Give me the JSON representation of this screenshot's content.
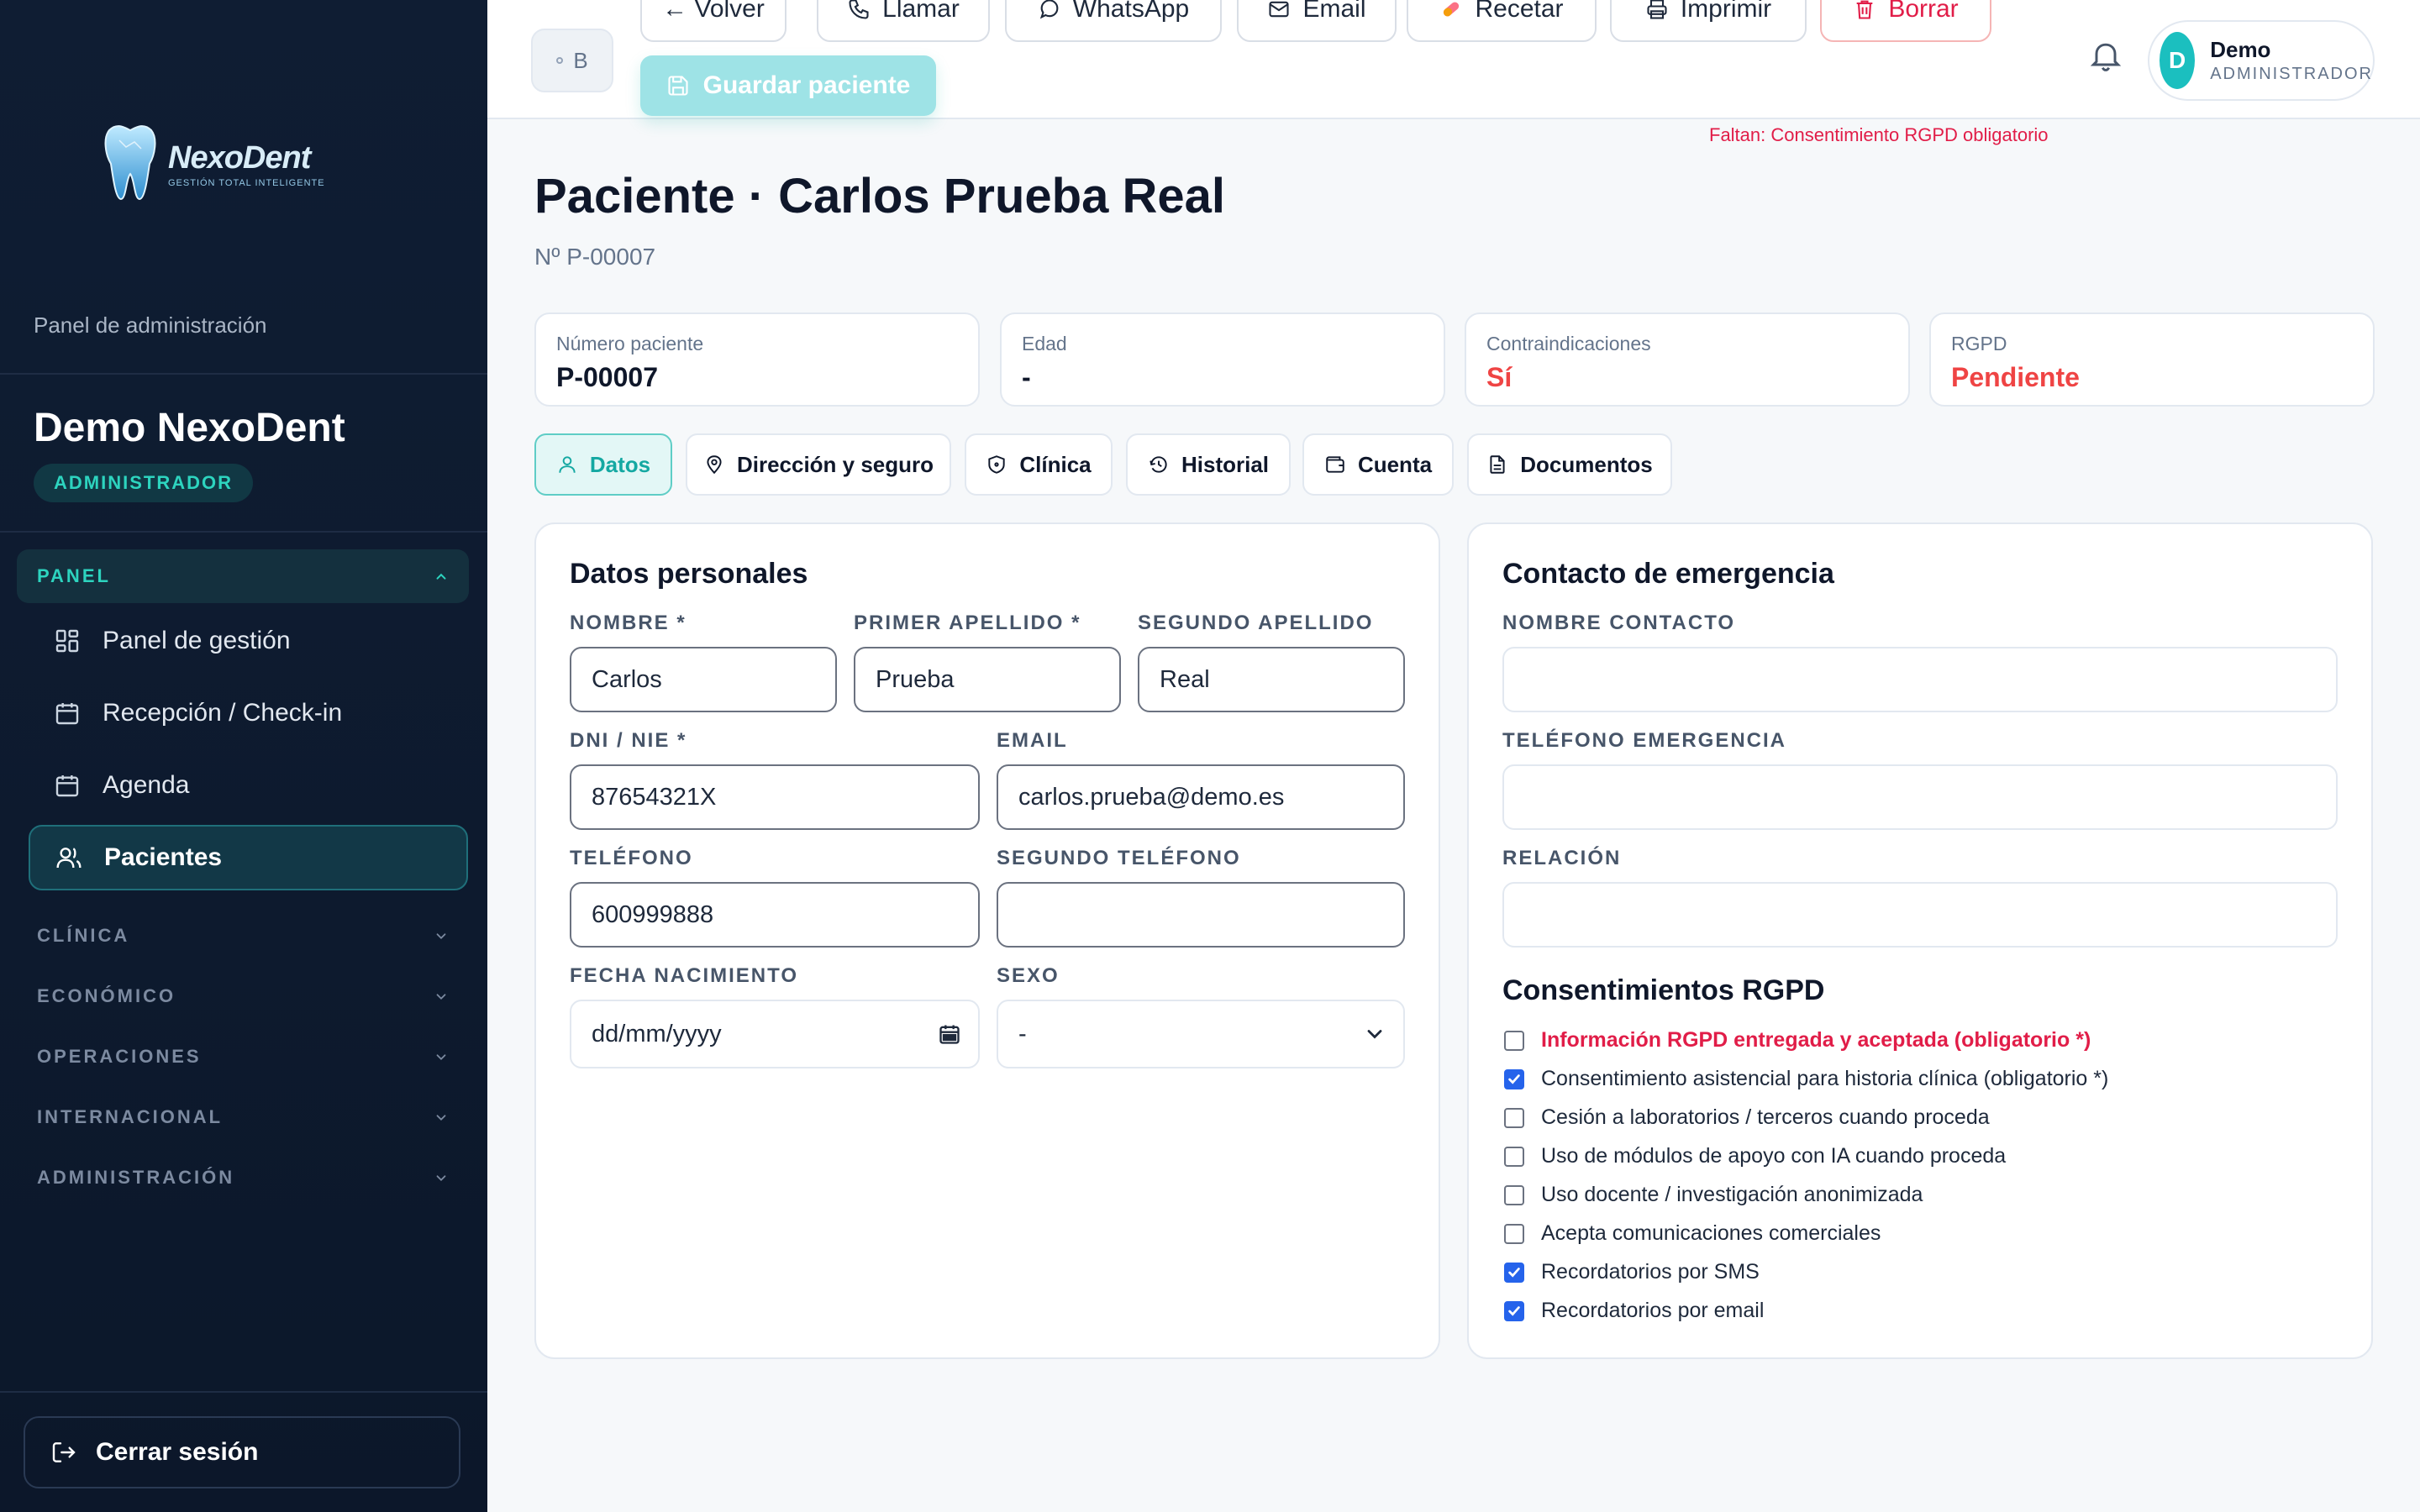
{
  "sidebar": {
    "logo_name": "NexoDent",
    "logo_tagline": "GESTIÓN TOTAL INTELIGENTE",
    "panel_label": "Panel de administración",
    "org_name": "Demo NexoDent",
    "role": "ADMINISTRADOR",
    "section_panel": "PANEL",
    "items": [
      {
        "label": "Panel de gestión",
        "icon": "dashboard-icon"
      },
      {
        "label": "Recepción / Check-in",
        "icon": "calendar-icon"
      },
      {
        "label": "Agenda",
        "icon": "calendar-icon"
      },
      {
        "label": "Pacientes",
        "icon": "users-icon",
        "active": true
      }
    ],
    "sections": [
      "CLÍNICA",
      "ECONÓMICO",
      "OPERACIONES",
      "INTERNACIONAL",
      "ADMINISTRACIÓN"
    ],
    "logout": "Cerrar sesión"
  },
  "topbar": {
    "chip": "B",
    "actions": [
      "← Volver",
      "Llamar",
      "WhatsApp",
      "Email",
      "Recetar",
      "Imprimir",
      "Borrar"
    ],
    "save": "Guardar paciente",
    "user_name": "Demo",
    "user_role": "ADMINISTRADOR",
    "avatar_letter": "D"
  },
  "warning": "Faltan: Consentimiento RGPD obligatorio",
  "page": {
    "title": "Paciente · Carlos Prueba Real",
    "subtitle": "Nº P-00007"
  },
  "stats": [
    {
      "label": "Número paciente",
      "value": "P-00007"
    },
    {
      "label": "Edad",
      "value": "-"
    },
    {
      "label": "Contraindicaciones",
      "value": "Sí"
    },
    {
      "label": "RGPD",
      "value": "Pendiente"
    }
  ],
  "tabs": [
    "Datos",
    "Dirección y seguro",
    "Clínica",
    "Historial",
    "Cuenta",
    "Documentos"
  ],
  "personal": {
    "title": "Datos personales",
    "nombre_label": "NOMBRE *",
    "nombre": "Carlos",
    "apellido1_label": "PRIMER APELLIDO *",
    "apellido1": "Prueba",
    "apellido2_label": "SEGUNDO APELLIDO",
    "apellido2": "Real",
    "dni_label": "DNI / NIE *",
    "dni": "87654321X",
    "email_label": "EMAIL",
    "email": "carlos.prueba@demo.es",
    "tel_label": "TELÉFONO",
    "tel": "600999888",
    "tel2_label": "SEGUNDO TELÉFONO",
    "tel2": "",
    "fecha_label": "FECHA NACIMIENTO",
    "fecha_placeholder": "dd/mm/yyyy",
    "sexo_label": "SEXO",
    "sexo": "-"
  },
  "emergency": {
    "title": "Contacto de emergencia",
    "nombre_label": "NOMBRE CONTACTO",
    "telefono_label": "TELÉFONO EMERGENCIA",
    "relacion_label": "RELACIÓN"
  },
  "consents": {
    "title": "Consentimientos RGPD",
    "items": [
      {
        "label": "Información RGPD entregada y aceptada (obligatorio *)",
        "checked": false,
        "required": true
      },
      {
        "label": "Consentimiento asistencial para historia clínica (obligatorio *)",
        "checked": true
      },
      {
        "label": "Cesión a laboratorios / terceros cuando proceda",
        "checked": false
      },
      {
        "label": "Uso de módulos de apoyo con IA cuando proceda",
        "checked": false
      },
      {
        "label": "Uso docente / investigación anonimizada",
        "checked": false
      },
      {
        "label": "Acepta comunicaciones comerciales",
        "checked": false
      },
      {
        "label": "Recordatorios por SMS",
        "checked": true
      },
      {
        "label": "Recordatorios por email",
        "checked": true
      }
    ]
  },
  "colors": {
    "accent": "#14b8a6",
    "danger": "#ef4444",
    "sidebar_bg": "#0f1d33"
  }
}
